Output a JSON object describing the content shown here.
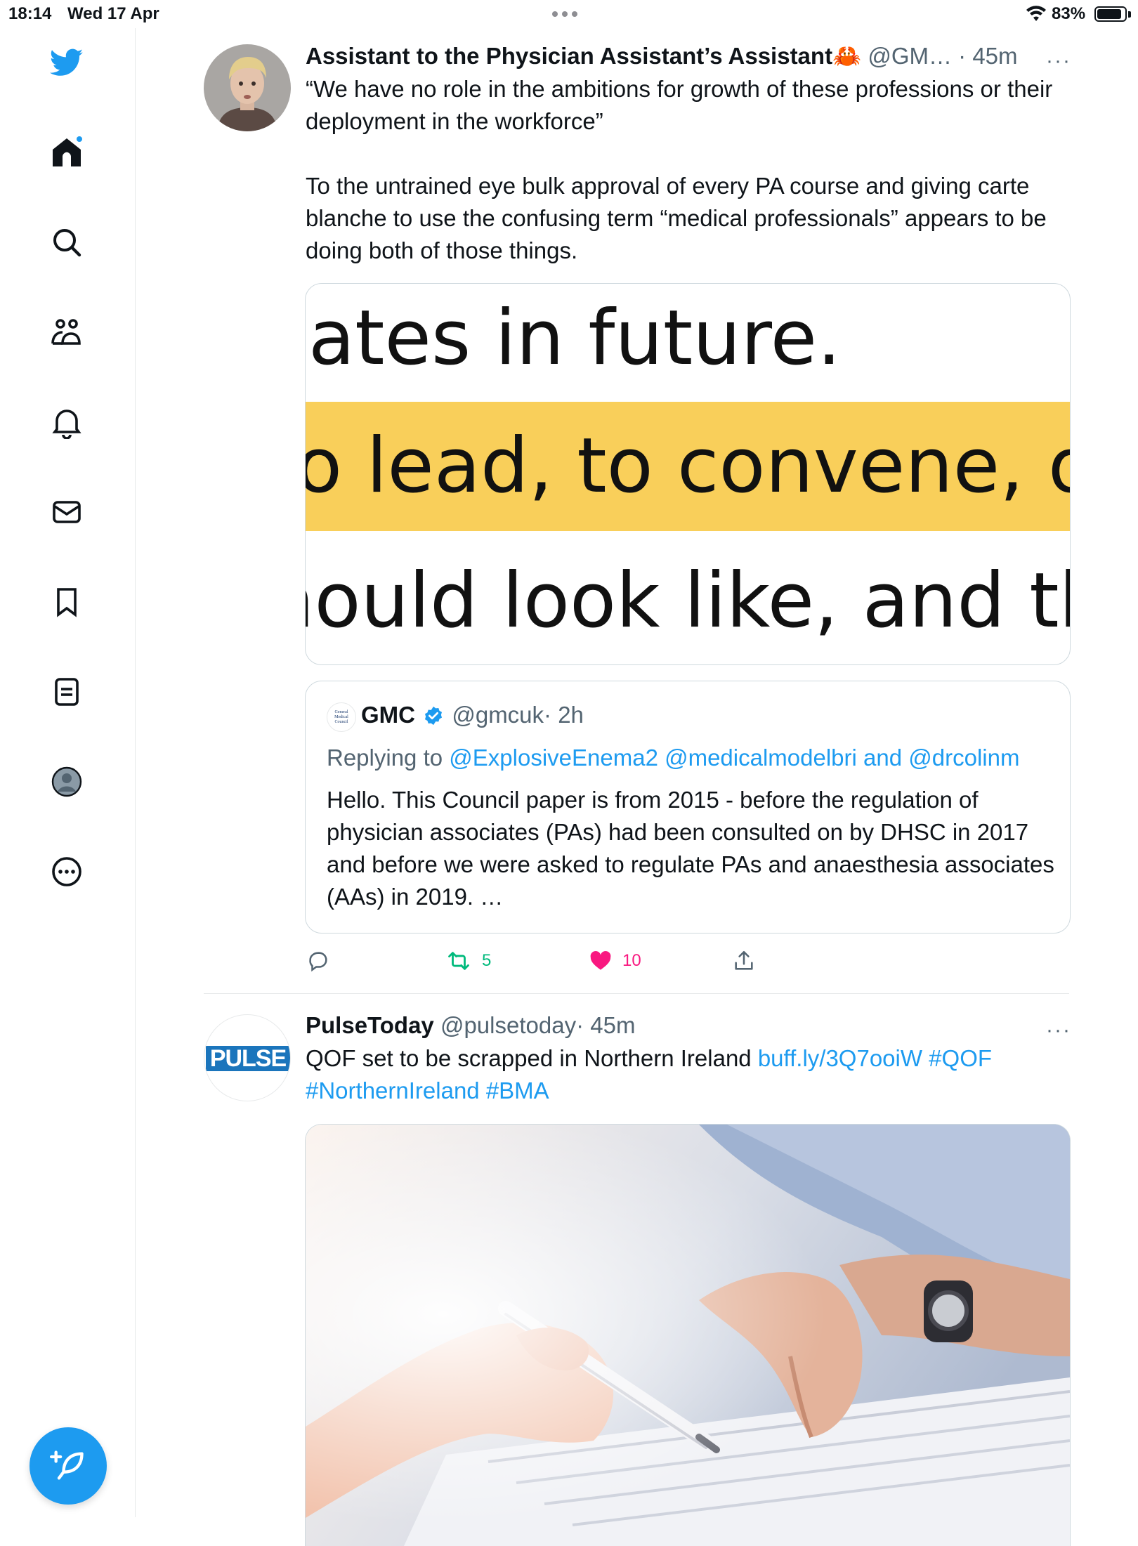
{
  "status_bar": {
    "time": "18:14",
    "date": "Wed 17 Apr",
    "battery": "83%"
  },
  "sidebar": {
    "items": [
      {
        "icon": "twitter-bird-icon"
      },
      {
        "icon": "home-icon"
      },
      {
        "icon": "search-icon"
      },
      {
        "icon": "communities-icon"
      },
      {
        "icon": "notifications-bell-icon"
      },
      {
        "icon": "messages-envelope-icon"
      },
      {
        "icon": "bookmark-icon"
      },
      {
        "icon": "lists-icon"
      },
      {
        "icon": "profile-icon"
      },
      {
        "icon": "more-circle-icon"
      }
    ],
    "compose_icon": "compose-feather-icon"
  },
  "tweets": [
    {
      "name": "Assistant to the Physician Assistant’s Assistant🦀",
      "handle": "@GM…",
      "time": "· 45m",
      "more": "···",
      "text_1": "“We have no role in the ambitions for growth of these professions or their deployment in the workforce”",
      "text_2": "To the untrained eye bulk approval of every PA course and giving carte blanche to use the confusing term “medical professionals” appears to be doing both of those things.",
      "image_lines": [
        "ates in future.",
        "o lead, to convene, or",
        "hould look like, and th"
      ],
      "quote": {
        "name": "GMC",
        "logo_text": "General Medical Council",
        "handle": "@gmcuk",
        "time": "· 2h",
        "replying_prefix": "Replying to",
        "replying_to": "@ExplosiveEnema2 @medicalmodelbri and @drcolinm",
        "text": "Hello. This Council paper is from 2015 - before the regulation of physician associates (PAs) had been consulted on by DHSC in 2017 and before we were asked to regulate PAs and anaesthesia associates (AAs) in 2019. …"
      },
      "retweets": "5",
      "likes": "10"
    },
    {
      "name": "PulseToday",
      "handle": "@pulsetoday",
      "time": "· 45m",
      "more": "···",
      "avatar_text": "PULSE",
      "text_plain": "QOF set to be scrapped in Northern Ireland ",
      "text_link": "buff.ly/3Q7ooiW #QOF #NorthernIreland #BMA"
    }
  ],
  "colors": {
    "accent": "#1d9bf0",
    "retweet": "#00ba7c",
    "like": "#f91880",
    "highlight": "#f9cf5a"
  }
}
